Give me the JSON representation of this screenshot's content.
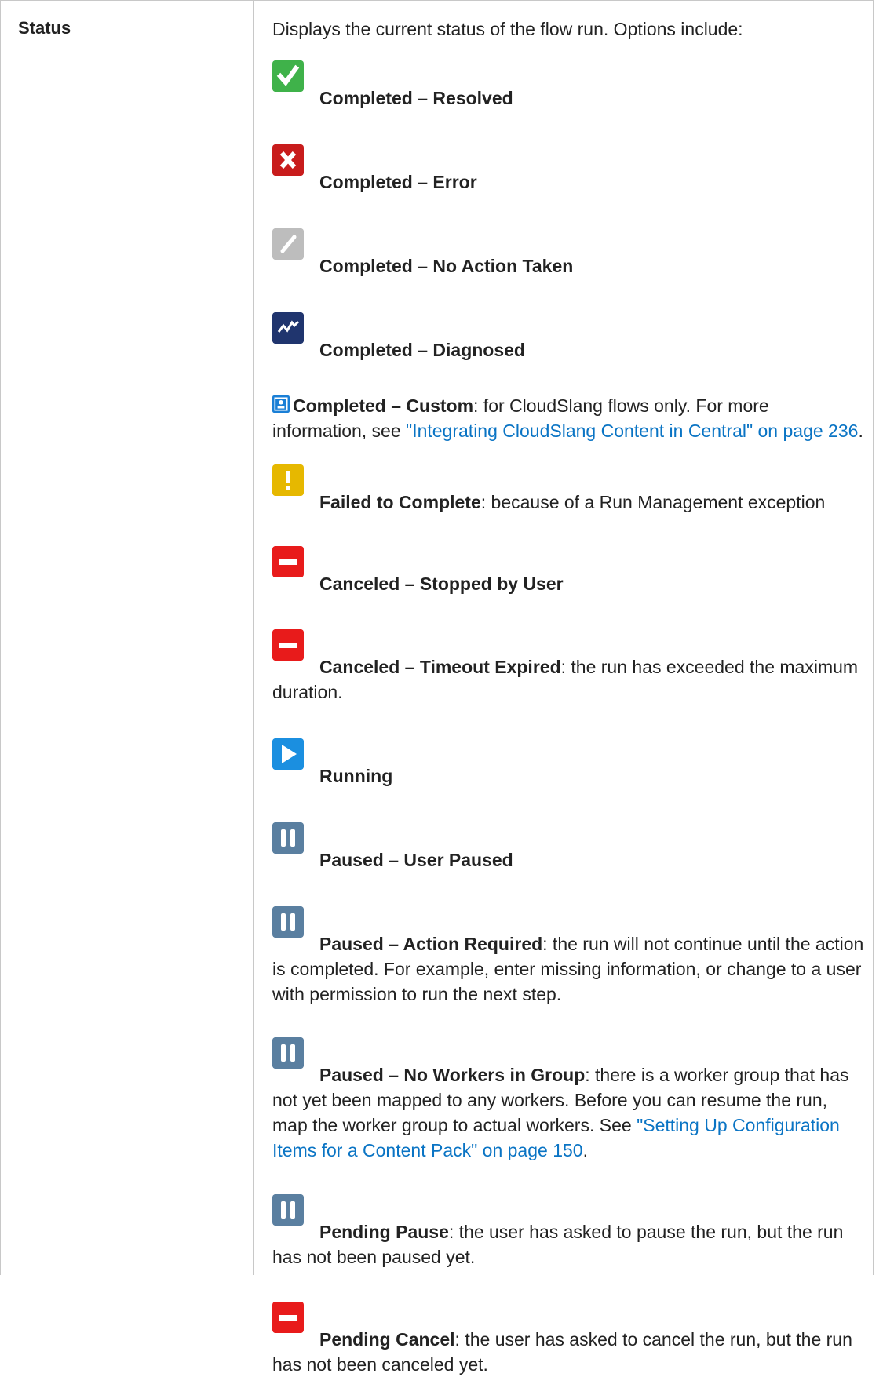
{
  "term": "Status",
  "intro": "Displays the current status of the flow run. Options include:",
  "entries": [
    {
      "icon": "check-icon",
      "color": "#3fb24a",
      "label": "Completed – Resolved",
      "sep": "",
      "text": ""
    },
    {
      "icon": "x-icon",
      "color": "#c81c1c",
      "label": "Completed – Error",
      "sep": "",
      "text": ""
    },
    {
      "icon": "slash-icon",
      "color": "#bdbdbd",
      "label": "Completed – No Action Taken",
      "sep": "",
      "text": ""
    },
    {
      "icon": "trend-icon",
      "color": "#20356e",
      "label": "Completed – Diagnosed",
      "sep": "",
      "text": ""
    },
    {
      "icon": "user-badge-icon",
      "color": "#1a7fd6",
      "label": "Completed – Custom",
      "sep": ":",
      "text": " for CloudSlang flows only. For more information, see ",
      "link": "\"Integrating CloudSlang Content in Central\" on page 236",
      "after": "."
    },
    {
      "icon": "exclamation-icon",
      "color": "#e6b800",
      "label": "Failed to Complete",
      "sep": ":",
      "text": " because of a Run Management exception"
    },
    {
      "icon": "minus-icon",
      "color": "#e81b1b",
      "label": "Canceled – Stopped by User",
      "sep": "",
      "text": ""
    },
    {
      "icon": "minus-icon",
      "color": "#e81b1b",
      "label": "Canceled – Timeout Expired",
      "sep": ":",
      "text": " the run has exceeded the maximum duration."
    },
    {
      "icon": "play-icon",
      "color": "#1b8fe0",
      "label": "Running",
      "sep": "",
      "text": ""
    },
    {
      "icon": "pause-icon",
      "color": "#5a7fa0",
      "label": "Paused – User Paused",
      "sep": "",
      "text": ""
    },
    {
      "icon": "pause-icon",
      "color": "#5a7fa0",
      "label": "Paused – Action Required",
      "sep": ":",
      "text": " the run will not continue until the action is completed. For example, enter missing information, or change to a user with permission to run the next step."
    },
    {
      "icon": "pause-icon",
      "color": "#5a7fa0",
      "label": "Paused – No Workers in Group",
      "sep": ":",
      "text": " there is a worker group that has not yet been mapped to any workers. Before you can resume the run, map the worker group to actual workers. See ",
      "link": "\"Setting Up Configuration Items for a Content Pack\" on page 150",
      "after": "."
    },
    {
      "icon": "pause-icon",
      "color": "#5a7fa0",
      "label": "Pending Pause",
      "sep": ":",
      "text": " the user has asked to pause the run, but the run has not been paused yet."
    },
    {
      "icon": "minus-icon",
      "color": "#e81b1b",
      "label": "Pending Cancel",
      "sep": ":",
      "text": " the user has asked to cancel the run, but the run has not been canceled yet."
    }
  ]
}
